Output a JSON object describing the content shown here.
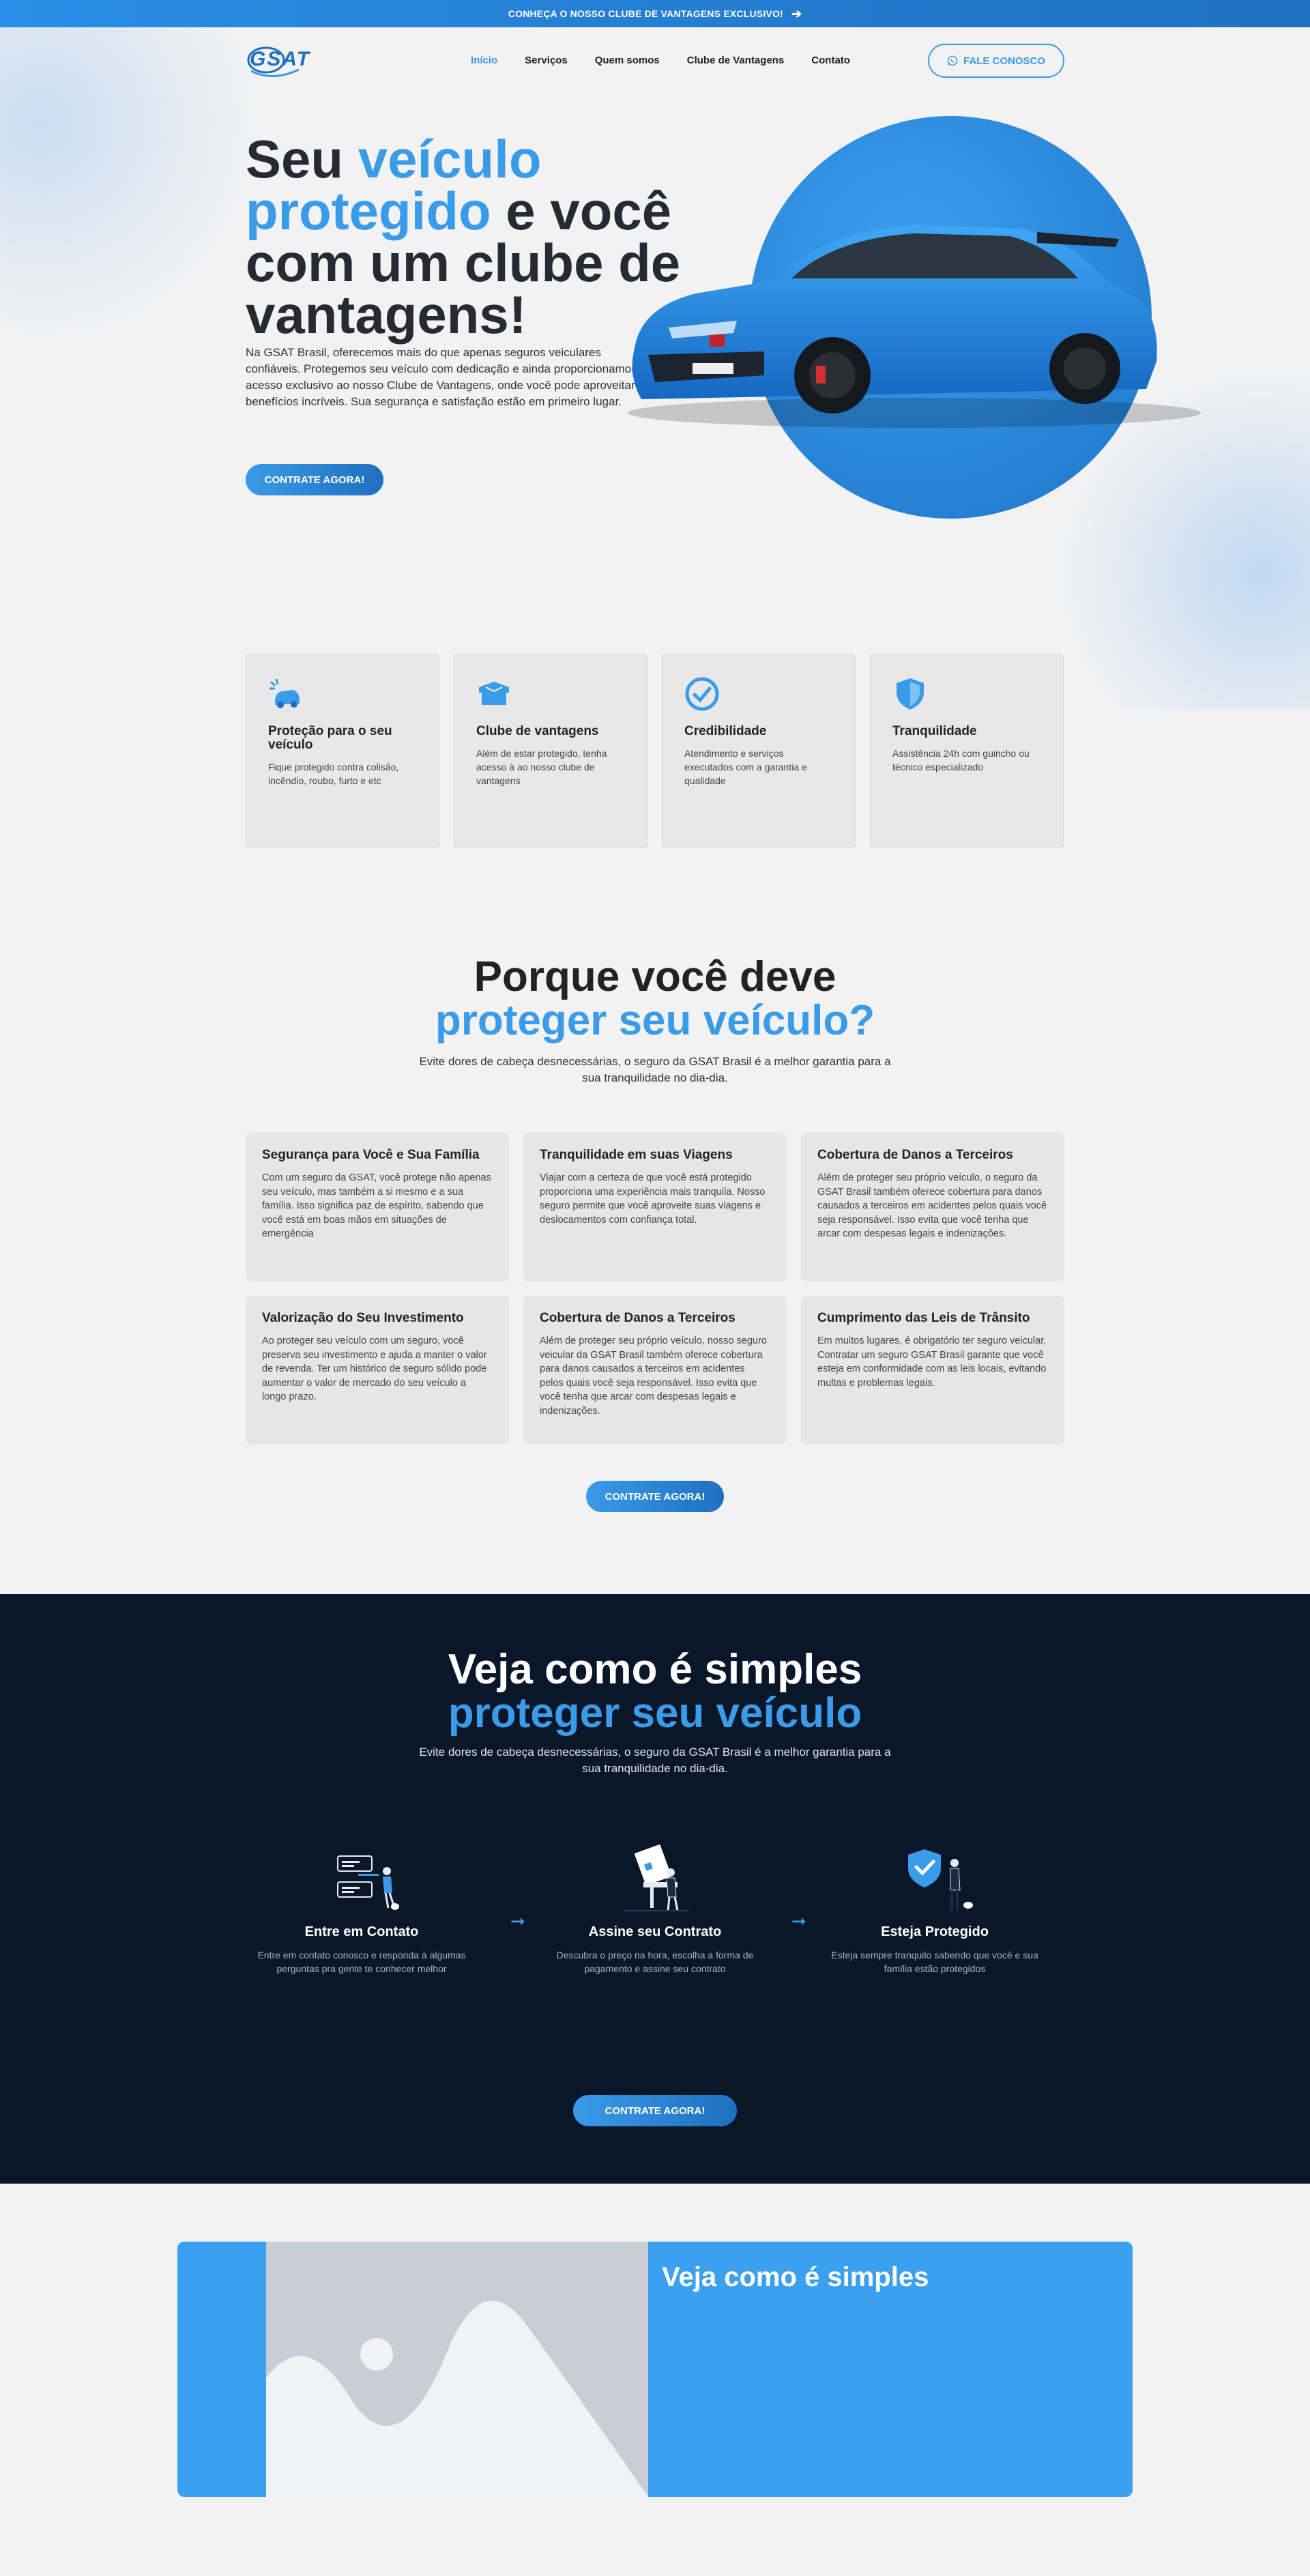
{
  "topbar": {
    "text": "CONHEÇA O NOSSO CLUBE DE VANTAGENS EXCLUSIVO!",
    "arrow_icon": "arrow-right-icon"
  },
  "header": {
    "logo_text": "GSAT",
    "nav": [
      {
        "label": "Início",
        "active": true
      },
      {
        "label": "Serviços",
        "active": false
      },
      {
        "label": "Quem somos",
        "active": false
      },
      {
        "label": "Clube de Vantagens",
        "active": false
      },
      {
        "label": "Contato",
        "active": false
      }
    ],
    "cta_label": "FALE CONOSCO",
    "cta_icon": "whatsapp-icon"
  },
  "hero": {
    "title_part1": "Seu ",
    "title_highlight": "veículo protegido",
    "title_part2": " e você com um clube de vantagens!",
    "description": "Na GSAT Brasil, oferecemos mais do que apenas seguros veiculares confiáveis. Protegemos seu veículo com dedicação e ainda proporcionamos acesso exclusivo ao nosso Clube de Vantagens, onde você pode aproveitar benefícios incríveis. Sua segurança e satisfação estão em primeiro lugar.",
    "cta_label": "CONTRATE AGORA!",
    "accent_color": "#3a9be8"
  },
  "features": [
    {
      "icon": "car-crash-icon",
      "title": "Proteção para o seu veículo",
      "text": "Fique protegido contra colisão, incêndio, roubo, furto e etc"
    },
    {
      "icon": "gift-box-icon",
      "title": "Clube de vantagens",
      "text": "Além de estar protegido, tenha acesso à ao nosso clube de vantagens"
    },
    {
      "icon": "check-circle-icon",
      "title": "Credibilidade",
      "text": "Atendimento e serviços executados com a garantia e qualidade"
    },
    {
      "icon": "shield-icon",
      "title": "Tranquilidade",
      "text": "Assistência 24h com guincho ou técnico especializado"
    }
  ],
  "why": {
    "title_line1": "Porque você deve",
    "title_line2": "proteger seu veículo?",
    "description": "Evite dores de cabeça desnecessárias, o seguro da GSAT Brasil é a melhor garantia para a sua tranquilidade no dia-dia.",
    "cta_label": "CONTRATE AGORA!",
    "reasons": [
      {
        "title": "Segurança para Você e Sua Família",
        "text": "Com um seguro da GSAT, você protege não apenas seu veículo, mas também a si mesmo e a sua família. Isso significa paz de espírito, sabendo que você está em boas mãos em situações de emergência"
      },
      {
        "title": "Tranquilidade em suas Viagens",
        "text": "Viajar com a certeza de que você está protegido proporciona uma experiência mais tranquila. Nosso seguro permite que você aproveite suas viagens e deslocamentos com confiança total."
      },
      {
        "title": "Cobertura de Danos a Terceiros",
        "text": "Além de proteger seu próprio veículo, o seguro da GSAT Brasil também oferece cobertura para danos causados a terceiros em acidentes pelos quais você seja responsável. Isso evita que você tenha que arcar com despesas legais e indenizações."
      },
      {
        "title": "Valorização do Seu Investimento",
        "text": "Ao proteger seu veículo com um seguro, você preserva seu investimento e ajuda a manter o valor de revenda. Ter um histórico de seguro sólido pode aumentar o valor de mercado do seu veículo a longo prazo."
      },
      {
        "title": "Cobertura de Danos a Terceiros",
        "text": "Além de proteger seu próprio veículo, nosso seguro veicular da GSAT Brasil também oferece cobertura para danos causados a terceiros em acidentes pelos quais você seja responsável. Isso evita que você tenha que arcar com despesas legais e indenizações."
      },
      {
        "title": "Cumprimento das Leis de Trânsito",
        "text": "Em muitos lugares, é obrigatório ter seguro veicular. Contratar um seguro GSAT Brasil garante que você esteja em conformidade com as leis locais, evitando multas e problemas legais."
      }
    ]
  },
  "simple": {
    "title_line1": "Veja como é simples",
    "title_line2": "proteger seu veículo",
    "description": "Evite dores de cabeça desnecessárias, o seguro da GSAT Brasil é a melhor garantia para a sua tranquilidade no dia-dia.",
    "cta_label": "CONTRATE AGORA!",
    "steps": [
      {
        "icon": "chat-person-illustration",
        "title": "Entre em Contato",
        "text": "Entre em contato conosco e responda à algumas perguntas pra gente te conhecer melhor"
      },
      {
        "icon": "sign-contract-illustration",
        "title": "Assine seu Contrato",
        "text": "Descubra o preço na hora, escolha a forma de pagamento e assine seu contrato"
      },
      {
        "icon": "shield-person-illustration",
        "title": "Esteja Protegido",
        "text": "Esteja sempre tranquilo sabendo que você e sua família estão protegidos"
      }
    ],
    "arrow_icon": "arrow-right-icon"
  },
  "bottom_box": {
    "title": "Veja como é simples",
    "image_icon": "image-placeholder-icon",
    "background_color": "#3ba0ef"
  }
}
